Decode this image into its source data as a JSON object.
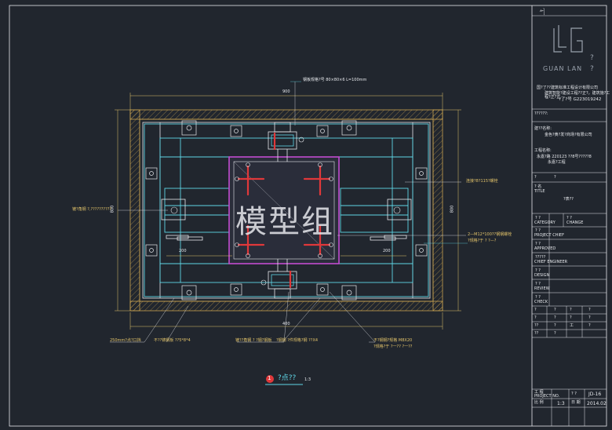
{
  "watermark": "模型组",
  "brand": {
    "logo_text": "GUAN  LAN",
    "mark": "?",
    "mark2": "?"
  },
  "title_block": {
    "top_label": "ሎ꧌",
    "company_line1": "国?了??建筑标准工程设计有限公司",
    "company_line2": "建筑智能?建设工程??正?，建筑施?工程?正?正",
    "company_line3": "?了?号   G223019242",
    "project_label": "??????:",
    "client_label": "建??名称:",
    "client_value": "金色?黄?发?商场?有限公司",
    "engineer_label": "工程名称:",
    "engineer_value": "永嘉?路  220123  ??8号?????8",
    "engineer_value2": "永嘉?工程",
    "row_q": "?",
    "row_q2": "?",
    "drawing_name_label": "?  名",
    "drawing_name_sub": "TITLE",
    "drawing_name_value": "?表??",
    "cells": [
      {
        "t1": "?  ?",
        "t2": "CATEGORY",
        "t3": "?  ?",
        "t4": "CHANGE"
      },
      {
        "t1": "?  ?",
        "t2": "PROJECT  CHIEF"
      },
      {
        "t1": "?  ?",
        "t2": "APPROVED"
      },
      {
        "t1": "?????",
        "t2": "CHIEF  ENGINEER"
      },
      {
        "t1": "?  ?",
        "t2": "DESIGN"
      },
      {
        "t1": "? ?",
        "t2": "REVIEW"
      },
      {
        "t1": "? ?",
        "t2": "CHECK"
      }
    ],
    "sig_rows": [
      [
        "?",
        "?",
        "?",
        "?"
      ],
      [
        "?",
        "?",
        "?",
        "?"
      ],
      [
        "??",
        "?",
        "工",
        "?"
      ],
      [
        "??",
        "?"
      ]
    ],
    "bottom": {
      "no_label": "工 程",
      "no_sub": "PROJECT NO.",
      "sheet_label": "?  ?",
      "scale_label": "比 例",
      "scale": "1:3",
      "date_label": "日 期",
      "sheet": "JD-16",
      "date": "2014.02"
    }
  },
  "annotations": {
    "top_label": "钢板规格?号 80×80×6  L=100mm",
    "dim_top": "900",
    "dim_bottom": "400",
    "dim_left": "800",
    "dim_right": "800",
    "dim_mid_left": "200",
    "dim_mid_right": "200",
    "left_note": "镀?角钢 ?,??????????",
    "right_note1": "连接?8?115?螺栓",
    "right_note2": "2—M12*100??钢钢螺栓",
    "right_note3": "?规格?于 ?  ?—?",
    "bottom_note1": "250mm?点?口挡",
    "bottom_note2": "不??铸钢板 ??5*8*4",
    "bottom_note3": "镀??角钢 ?  ?钢?钢板",
    "bottom_note4": "?钢钢  ?件规格?钢 ??X4",
    "bottom_note5": "不?钢钢?规格 M8X20",
    "bottom_note6": "?规格?于 ?一?? ?一??"
  },
  "caption": {
    "number": "1",
    "text": "?点??",
    "scale": "1:3"
  },
  "colors": {
    "bg": "#21262e",
    "white": "#e6e8ec",
    "cyan": "#5fd6e6",
    "yellow": "#e2c36a",
    "magenta": "#c24bd0",
    "red": "#e0383a",
    "orange": "#d89a4a"
  }
}
